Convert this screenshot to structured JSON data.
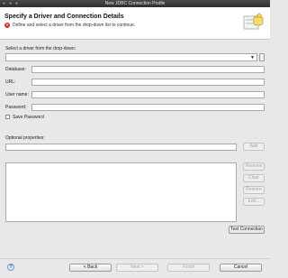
{
  "window": {
    "title": "New JDBC Connection Profile"
  },
  "header": {
    "title": "Specify a Driver and Connection Details",
    "message": "Define and select a driver from the drop-down list to continue.",
    "message_icon": "error-icon",
    "wizard_icon": "database-wizard-icon"
  },
  "driver": {
    "label": "Select a driver from the drop-down:",
    "value": ""
  },
  "fields": {
    "database": {
      "label": "Database:",
      "value": ""
    },
    "url": {
      "label": "URL:",
      "value": ""
    },
    "username": {
      "label": "User name:",
      "value": ""
    },
    "password": {
      "label": "Password:",
      "value": ""
    }
  },
  "save_password": {
    "label": "Save Password",
    "checked": false
  },
  "optional": {
    "label": "Optional properties:",
    "value": "",
    "add_label": "Add"
  },
  "side_buttons": {
    "remove": "Remove",
    "clear": "Clear",
    "restore": "Restore",
    "edit": "Edit..."
  },
  "test_connection_label": "Test Connection",
  "footer": {
    "back": "< Back",
    "next": "Next >",
    "finish": "Finish",
    "cancel": "Cancel",
    "help": "?"
  }
}
